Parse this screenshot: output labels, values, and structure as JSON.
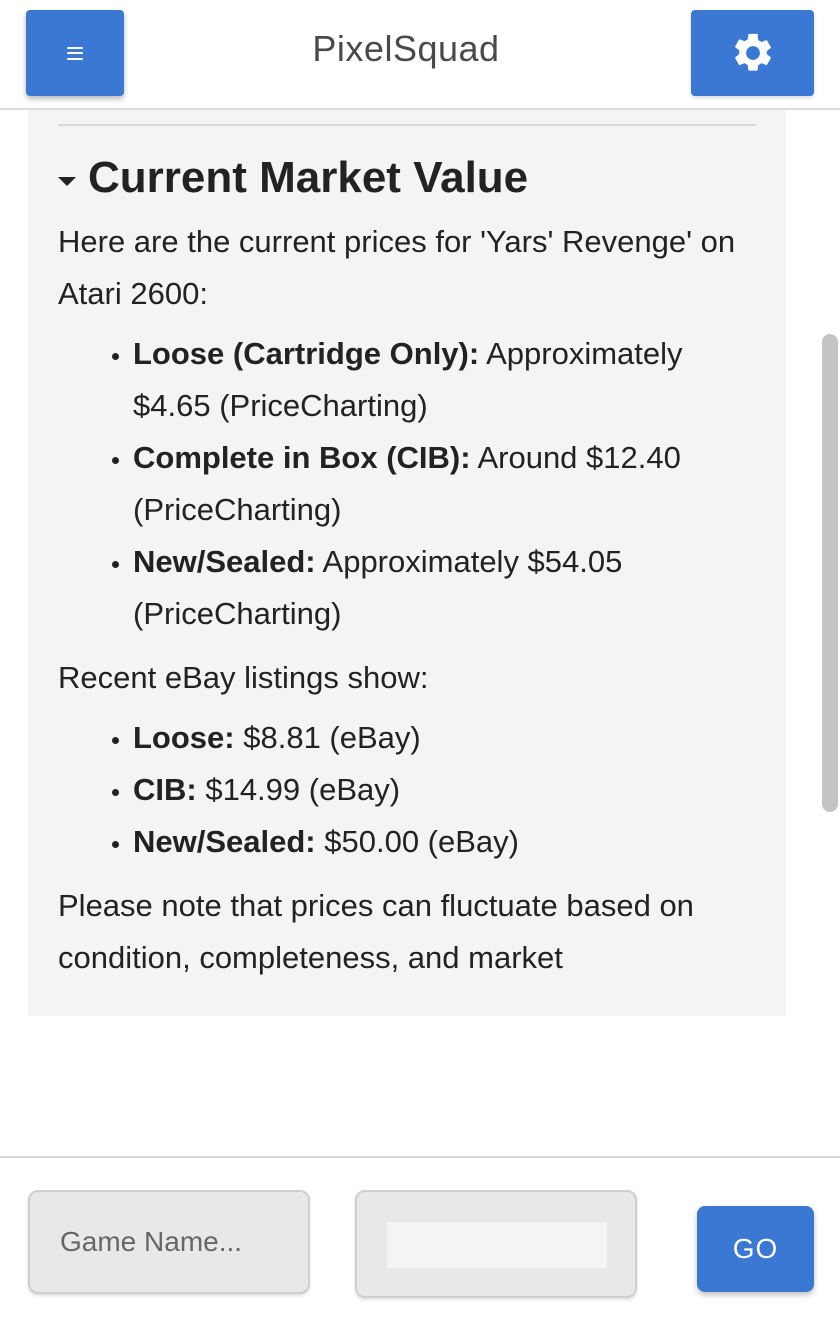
{
  "header": {
    "menu_icon": "hamburger-menu-icon",
    "title": "PixelSquad",
    "settings_icon": "gear-icon"
  },
  "colors": {
    "accent": "#3a78d4",
    "panel_bg": "#f4f4f4"
  },
  "content": {
    "section_title": "Current Market Value",
    "intro": "Here are the current prices for 'Yars' Revenge' on Atari 2600:",
    "pricecharting": [
      {
        "label": "Loose (Cartridge Only):",
        "value": " Approximately $4.65 (PriceCharting)"
      },
      {
        "label": "Complete in Box (CIB):",
        "value": " Around $12.40 (PriceCharting)"
      },
      {
        "label": "New/Sealed:",
        "value": " Approximately $54.05 (PriceCharting)"
      }
    ],
    "ebay_intro": "Recent eBay listings show:",
    "ebay": [
      {
        "label": "Loose:",
        "value": " $8.81 (eBay)"
      },
      {
        "label": "CIB:",
        "value": " $14.99 (eBay)"
      },
      {
        "label": "New/Sealed:",
        "value": " $50.00 (eBay)"
      }
    ],
    "note": "Please note that prices can fluctuate based on condition, completeness, and market"
  },
  "footer": {
    "game_input_placeholder": "Game Name...",
    "game_input_value": "",
    "platform_selected": "",
    "go_label": "GO"
  }
}
